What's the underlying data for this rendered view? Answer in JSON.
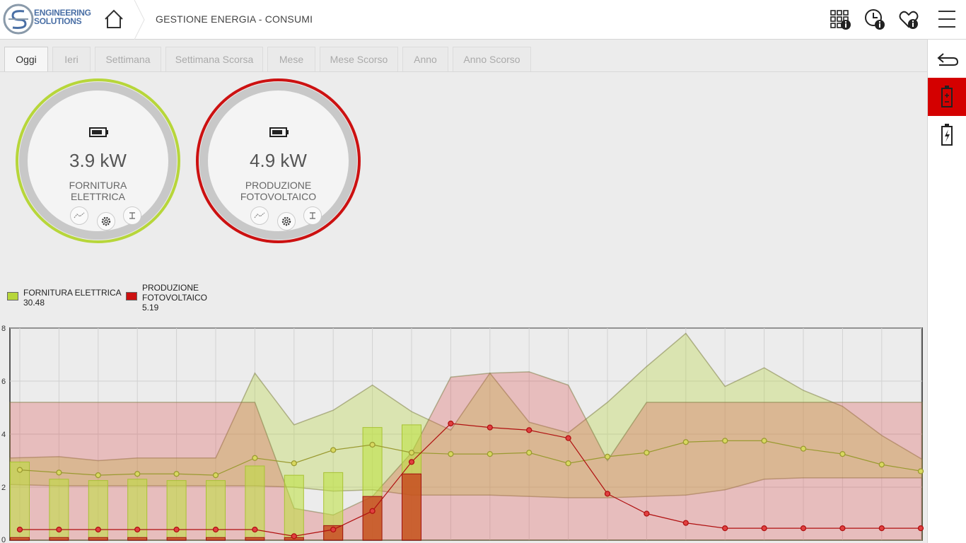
{
  "header": {
    "logo_line1": "ENGINEERING",
    "logo_line2": "SOLUTIONS",
    "title": "GESTIONE ENERGIA - CONSUMI",
    "icons": [
      "home-icon",
      "grid-info-icon",
      "clock-info-icon",
      "heart-info-icon",
      "menu-icon"
    ]
  },
  "sidebar": {
    "icons": [
      "back-arrow-icon",
      "battery-icon",
      "battery-charge-icon"
    ]
  },
  "tabs": [
    "Oggi",
    "Ieri",
    "Settimana",
    "Settimana Scorsa",
    "Mese",
    "Mese Scorso",
    "Anno",
    "Anno Scorso"
  ],
  "active_tab": "Oggi",
  "gauges": [
    {
      "value": "3.9 kW",
      "label1": "FORNITURA",
      "label2": "ELETTRICA",
      "ring_color": "#b7d63a"
    },
    {
      "value": "4.9 kW",
      "label1": "PRODUZIONE",
      "label2": "FOTOVOLTAICO",
      "ring_color": "#cc1111"
    }
  ],
  "legend": [
    {
      "name": "FORNITURA ELETTRICA",
      "total": "30.48",
      "color": "#b7d63a"
    },
    {
      "name_line1": "PRODUZIONE",
      "name_line2": "FOTOVOLTAICO",
      "total": "5.19",
      "color": "#cc1111"
    }
  ],
  "chart_data": {
    "type": "bar",
    "ylim": [
      0,
      8
    ],
    "yticks": [
      "0",
      "2",
      "4",
      "6",
      "8"
    ],
    "grid": true,
    "series": [
      {
        "name": "FORNITURA ELETTRICA",
        "color": "#b7d63a",
        "bars": [
          2.95,
          2.3,
          2.25,
          2.3,
          2.25,
          2.25,
          2.8,
          2.45,
          2.55,
          4.25,
          4.35
        ],
        "line": [
          2.65,
          2.55,
          2.45,
          2.5,
          2.5,
          2.45,
          3.1,
          2.9,
          3.4,
          3.6,
          3.3,
          3.25,
          3.25,
          3.3,
          2.9,
          3.15,
          3.3,
          3.7,
          3.75,
          3.75,
          3.45,
          3.25,
          2.85,
          2.6
        ],
        "band_upper": [
          3.1,
          3.15,
          3.0,
          3.1,
          3.1,
          3.1,
          6.3,
          4.35,
          4.9,
          5.85,
          4.85,
          4.15,
          6.3,
          4.45,
          4.05,
          5.2,
          6.55,
          7.8,
          5.8,
          6.5,
          5.65,
          5.05,
          3.95,
          3.05
        ],
        "band_lower": [
          2.1,
          2.05,
          2.05,
          2.05,
          2.05,
          2.05,
          2.05,
          2.0,
          1.85,
          1.9,
          1.7,
          1.7,
          1.7,
          1.65,
          1.6,
          1.6,
          1.65,
          1.7,
          1.9,
          2.3,
          2.35,
          2.35,
          2.35,
          2.35
        ]
      },
      {
        "name": "PRODUZIONE FOTOVOLTAICO",
        "color": "#cc1111",
        "bars": [
          0.1,
          0.1,
          0.1,
          0.1,
          0.1,
          0.1,
          0.1,
          0.1,
          0.55,
          1.65,
          2.5
        ],
        "line": [
          0.4,
          0.4,
          0.4,
          0.4,
          0.4,
          0.4,
          0.4,
          0.15,
          0.4,
          1.1,
          2.95,
          4.4,
          4.25,
          4.15,
          3.85,
          1.75,
          1.0,
          0.65,
          0.45,
          0.45,
          0.45,
          0.45,
          0.45,
          0.45
        ],
        "band_upper": [
          5.2,
          5.2,
          5.2,
          5.2,
          5.2,
          5.2,
          5.2,
          1.2,
          0.95,
          1.65,
          3.3,
          6.15,
          6.3,
          6.35,
          5.85,
          3.0,
          5.2,
          5.2,
          5.2,
          5.2,
          5.2,
          5.2,
          5.2,
          5.2
        ],
        "band_lower": [
          0,
          0,
          0,
          0,
          0,
          0,
          0,
          0,
          0,
          0,
          0,
          0,
          0,
          0,
          0,
          0,
          0,
          0,
          0,
          0,
          0,
          0,
          0,
          0
        ]
      }
    ]
  }
}
